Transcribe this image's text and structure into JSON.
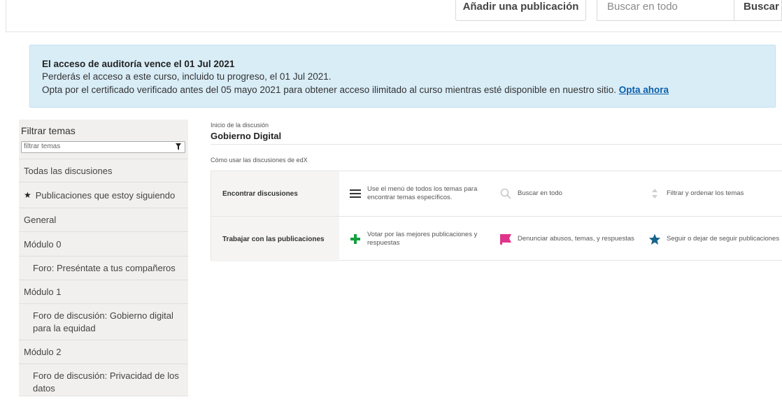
{
  "topbar": {
    "add_post_label": "Añadir una publicación",
    "search_placeholder": "Buscar en todo",
    "search_button_label": "Buscar"
  },
  "alert": {
    "title": "El acceso de auditoría vence el 01 Jul 2021",
    "line1": "Perderás el acceso a este curso, incluido tu progreso, el 01 Jul 2021.",
    "line2": "Opta por el certificado verificado antes del 05 mayo 2021 para obtener acceso ilimitado al curso mientras esté disponible en nuestro sitio.",
    "link_label": "Opta ahora"
  },
  "sidebar": {
    "heading": "Filtrar temas",
    "filter_placeholder": "filtrar temas",
    "items": [
      {
        "label": "Todas las discusiones"
      },
      {
        "label": "Publicaciones que estoy siguiendo"
      },
      {
        "label": "General"
      },
      {
        "label": "Módulo 0"
      },
      {
        "label": "Foro: Preséntate a tus compañeros"
      },
      {
        "label": "Módulo 1"
      },
      {
        "label": "Foro de discusión: Gobierno digital para la equidad"
      },
      {
        "label": "Módulo 2"
      },
      {
        "label": "Foro de discusión: Privacidad de los datos"
      }
    ]
  },
  "main": {
    "breadcrumb": "Inicio de la discusión",
    "title": "Gobierno Digital",
    "howto": "Cómo usar las discusiones de edX",
    "rows": [
      {
        "label": "Encontrar discusiones",
        "cells": [
          {
            "icon": "menu-icon",
            "text": "Use el menú de todos los temas para encontrar temas específicos."
          },
          {
            "icon": "search-icon",
            "text": "Buscar en todo"
          },
          {
            "icon": "sort-icon",
            "text": "Filtrar y ordenar los temas"
          }
        ]
      },
      {
        "label": "Trabajar con las publicaciones",
        "cells": [
          {
            "icon": "plus-icon",
            "text": "Votar por las mejores publicaciones y respuestas"
          },
          {
            "icon": "flag-icon",
            "text": "Denunciar abusos, temas, y respuestas"
          },
          {
            "icon": "star-icon",
            "text": "Seguir o dejar de seguir publicaciones"
          }
        ]
      }
    ]
  },
  "colors": {
    "alert_bg": "#d9edf7",
    "link": "#0b5ea9",
    "plus_green": "#13a03e",
    "flag_pink": "#e0348b",
    "star_blue": "#18638c"
  }
}
